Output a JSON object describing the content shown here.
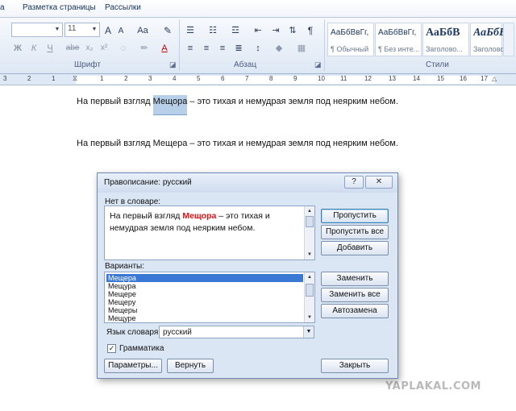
{
  "menu": {
    "tab_fragment": "а",
    "tab_layout": "Разметка страницы",
    "tab_mailings": "Рассылки"
  },
  "ribbon": {
    "font": {
      "size_value": "11",
      "group_label": "Шрифт",
      "grow_label": "A",
      "shrink_label": "A",
      "case_label": "Aa",
      "bold": "Ж",
      "italic": "К",
      "underline": "Ч",
      "strike": "abe",
      "sub": "x₂",
      "sup": "x²",
      "font_color": "A"
    },
    "paragraph": {
      "group_label": "Абзац",
      "pilcrow": "¶"
    },
    "styles": {
      "group_label": "Стили",
      "items": [
        {
          "sample": "АаБбВвГг,",
          "name": "¶ Обычный"
        },
        {
          "sample": "АаБбВвГг,",
          "name": "¶ Без инте..."
        },
        {
          "sample": "АаБбВ",
          "name": "Заголово..."
        },
        {
          "sample": "АаБбВ",
          "name": "Заголово..."
        }
      ]
    }
  },
  "ruler": {
    "numbers": [
      "3",
      "2",
      "1",
      "1",
      "2",
      "3",
      "4",
      "5",
      "6",
      "7",
      "8",
      "9",
      "10",
      "11",
      "12",
      "13",
      "14",
      "15",
      "16",
      "17"
    ]
  },
  "document": {
    "line1_before": "На первый взгляд ",
    "line1_word": "Мещора",
    "line1_after": " – это тихая и немудрая земля под неярким небом.",
    "line2": "На первый взгляд Мещера – это тихая и немудрая земля под неярким небом."
  },
  "watermark": "YAPLAKAL.COM",
  "dialog": {
    "title": "Правописание: русский",
    "help": "?",
    "close": "✕",
    "not_in_dict_label": "Нет в словаре:",
    "context_before": "На первый взгляд ",
    "context_word": "Мещора",
    "context_after": " – это тихая и немудрая земля под неярким небом.",
    "suggestions_label": "Варианты:",
    "suggestions": [
      "Мещера",
      "Мещура",
      "Мещере",
      "Мещеру",
      "Мещеры",
      "Мещуре"
    ],
    "language_label": "Язык словаря:",
    "language_value": "русский",
    "grammar_label": "Грамматика",
    "grammar_checked": true,
    "buttons": {
      "skip": "Пропустить",
      "skip_all": "Пропустить все",
      "add": "Добавить",
      "replace": "Заменить",
      "replace_all": "Заменить все",
      "autocorrect": "Автозамена",
      "options": "Параметры...",
      "undo": "Вернуть",
      "close": "Закрыть"
    }
  }
}
